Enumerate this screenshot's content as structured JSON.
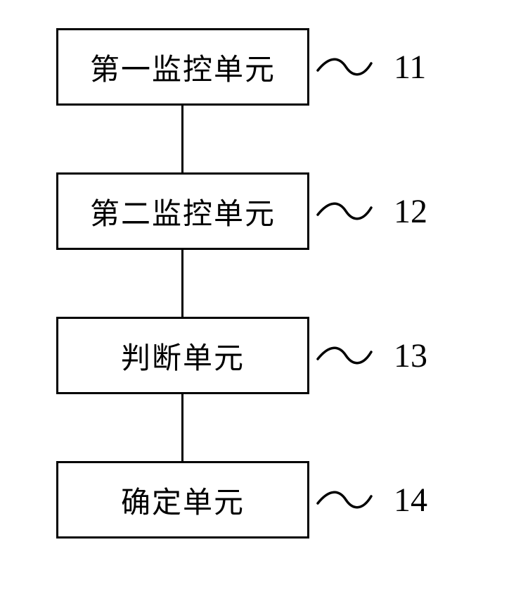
{
  "diagram": {
    "nodes": [
      {
        "label": "第一监控单元",
        "ref": "11"
      },
      {
        "label": "第二监控单元",
        "ref": "12"
      },
      {
        "label": "判断单元",
        "ref": "13"
      },
      {
        "label": "确定单元",
        "ref": "14"
      }
    ]
  }
}
